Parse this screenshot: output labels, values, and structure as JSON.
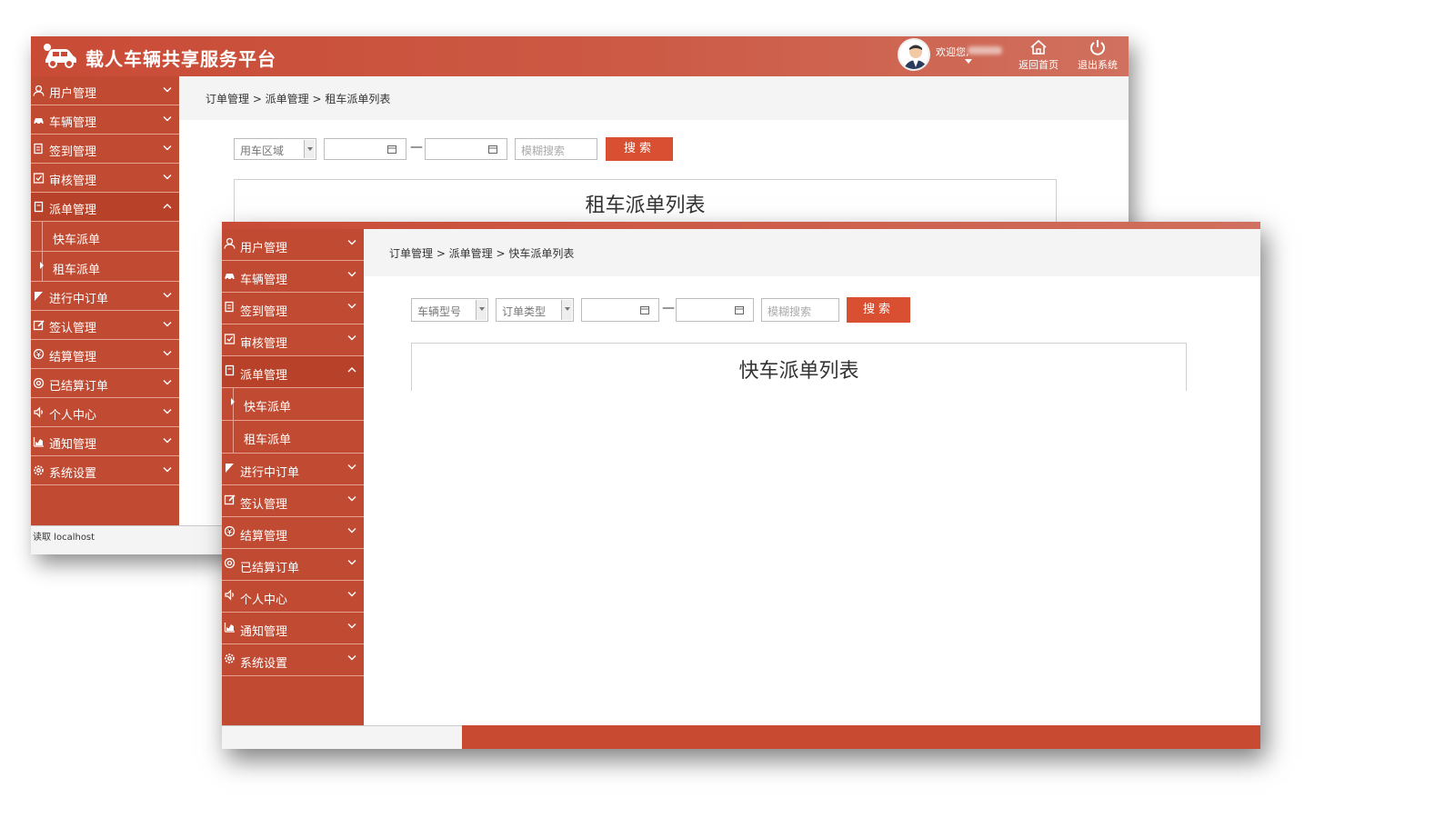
{
  "app": {
    "title": "载人车辆共享服务平台",
    "welcome": "欢迎您,",
    "home_label": "返回首页",
    "logout_label": "退出系统"
  },
  "colors": {
    "accent": "#c94b36",
    "button": "#d94f31",
    "sidebar": "#c04a32"
  },
  "menu": [
    {
      "label": "用户管理",
      "icon": "user-icon"
    },
    {
      "label": "车辆管理",
      "icon": "car-icon"
    },
    {
      "label": "签到管理",
      "icon": "checkin-icon"
    },
    {
      "label": "审核管理",
      "icon": "audit-icon"
    },
    {
      "label": "派单管理",
      "icon": "dispatch-icon"
    },
    {
      "label": "进行中订单",
      "icon": "ongoing-icon"
    },
    {
      "label": "签认管理",
      "icon": "sign-icon"
    },
    {
      "label": "结算管理",
      "icon": "settle-icon"
    },
    {
      "label": "已结算订单",
      "icon": "settled-icon"
    },
    {
      "label": "个人中心",
      "icon": "speaker-icon"
    },
    {
      "label": "通知管理",
      "icon": "chart-icon"
    },
    {
      "label": "系统设置",
      "icon": "gear-icon"
    }
  ],
  "submenu": [
    "快车派单",
    "租车派单"
  ],
  "back_window": {
    "breadcrumb": "订单管理 > 派单管理 > 租车派单列表",
    "filter_area": "用车区域",
    "fuzzy_placeholder": "模糊搜索",
    "search_label": "搜索",
    "panel_title": "租车派单列表",
    "status": "读取 localhost"
  },
  "front_window": {
    "breadcrumb": "订单管理 > 派单管理 > 快车派单列表",
    "filter_model": "车辆型号",
    "filter_type": "订单类型",
    "fuzzy_placeholder": "模糊搜索",
    "search_label": "搜索",
    "panel_title": "快车派单列表"
  },
  "range_dash": "—"
}
